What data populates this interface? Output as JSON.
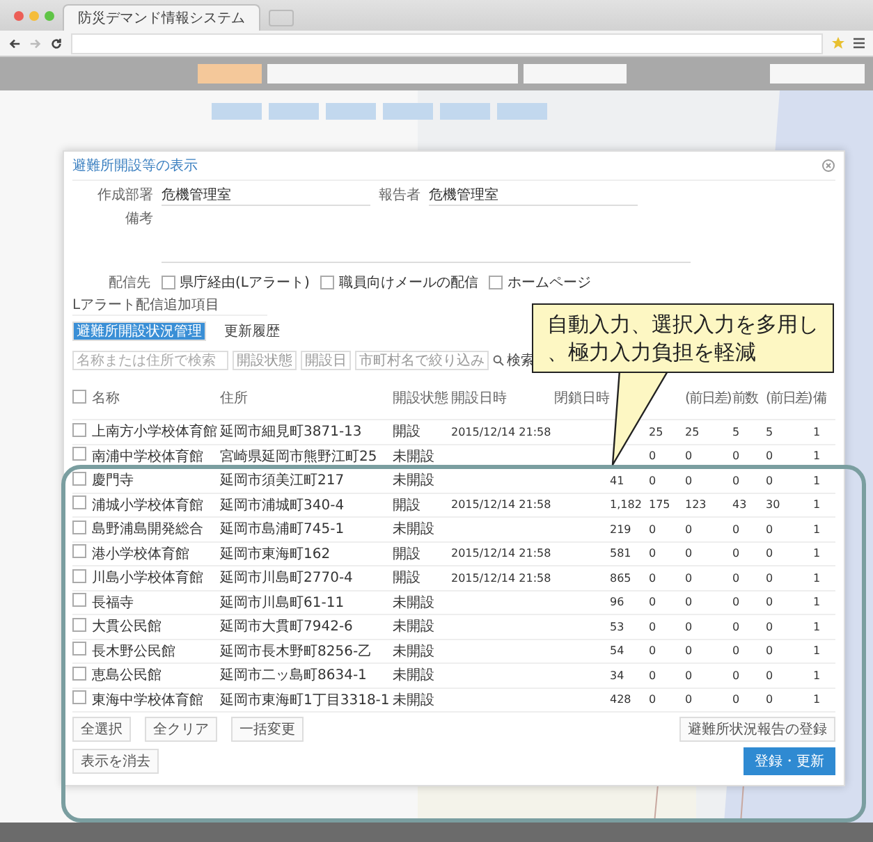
{
  "browser": {
    "tab_title": "防災デマンド情報システム"
  },
  "modal": {
    "title": "避難所開設等の表示",
    "fields": [
      {
        "label": "作成部署",
        "value": "危機管理室"
      },
      {
        "label": "報告者",
        "value": "危機管理室"
      }
    ],
    "remarks_label": "備考",
    "delivery": {
      "label": "配信先",
      "options": [
        {
          "label": "県庁経由(Lアラート)",
          "checked": false
        },
        {
          "label": "職員向けメールの配信",
          "checked": false
        },
        {
          "label": "ホームページ",
          "checked": false
        }
      ]
    },
    "section_label": "Lアラート配信追加項目",
    "tabs": [
      {
        "label": "避難所開設状況管理",
        "selected": true
      },
      {
        "label": "更新履歴",
        "selected": false
      }
    ],
    "filters": {
      "search_placeholder": "名称または住所で検索",
      "selects": [
        "開設状態",
        "開設日",
        "市町村名で絞り込み"
      ],
      "search_button": "検索"
    },
    "table": {
      "columns": [
        "名称",
        "住所",
        "開設状態",
        "開設日時",
        "閉鎖日時"
      ],
      "all_checked": false,
      "count_columns": [
        "(前日差)",
        "前数",
        "(前日差)",
        "備"
      ],
      "rows": [
        {
          "checked": false,
          "name": "上南方小学校体育館",
          "address": "延岡市細見町3871-13",
          "status": "開設",
          "opened": "2015/12/14 21:58",
          "counts": [
            "25",
            "25",
            "5",
            "5",
            "1"
          ]
        },
        {
          "checked": false,
          "name": "南浦中学校体育館",
          "address": "宮崎県延岡市熊野江町25",
          "status": "未開設",
          "counts": [
            "0",
            "0",
            "0",
            "0",
            "1"
          ]
        },
        {
          "checked": false,
          "name": "慶門寺",
          "address": "延岡市須美江町217",
          "status": "未開設",
          "counts": [
            "41",
            "0",
            "0",
            "0",
            "0",
            "1"
          ]
        },
        {
          "checked": false,
          "name": "浦城小学校体育館",
          "address": "延岡市浦城町340-4",
          "status": "開設",
          "opened": "2015/12/14 21:58",
          "counts": [
            "1,182",
            "175",
            "123",
            "43",
            "30",
            "1"
          ]
        },
        {
          "checked": false,
          "name": "島野浦島開発総合",
          "address": "延岡市島浦町745-1",
          "status": "未開設",
          "counts": [
            "219",
            "0",
            "0",
            "0",
            "0",
            "1"
          ]
        },
        {
          "checked": false,
          "name": "港小学校体育館",
          "address": "延岡市東海町162",
          "status": "開設",
          "opened": "2015/12/14 21:58",
          "counts": [
            "581",
            "0",
            "0",
            "0",
            "0",
            "1"
          ]
        },
        {
          "checked": false,
          "name": "川島小学校体育館",
          "address": "延岡市川島町2770-4",
          "status": "開設",
          "opened": "2015/12/14 21:58",
          "counts": [
            "865",
            "0",
            "0",
            "0",
            "0",
            "1"
          ]
        },
        {
          "checked": false,
          "name": "長福寺",
          "address": "延岡市川島町61-11",
          "status": "未開設",
          "counts": [
            "96",
            "0",
            "0",
            "0",
            "0",
            "1"
          ]
        },
        {
          "checked": false,
          "name": "大貫公民館",
          "address": "延岡市大貫町7942-6",
          "status": "未開設",
          "counts": [
            "53",
            "0",
            "0",
            "0",
            "0",
            "1"
          ]
        },
        {
          "checked": false,
          "name": "長木野公民館",
          "address": "延岡市長木野町8256-乙",
          "status": "未開設",
          "counts": [
            "54",
            "0",
            "0",
            "0",
            "0",
            "1"
          ]
        },
        {
          "checked": false,
          "name": "恵島公民館",
          "address": "延岡市二ッ島町8634-1",
          "status": "未開設",
          "counts": [
            "34",
            "0",
            "0",
            "0",
            "0",
            "1"
          ]
        },
        {
          "checked": false,
          "name": "東海中学校体育館",
          "address": "延岡市東海町1丁目3318-1",
          "status": "未開設",
          "counts": [
            "428",
            "0",
            "0",
            "0",
            "0",
            "1"
          ]
        }
      ]
    },
    "footer_buttons": [
      "全選択",
      "全クリア",
      "一括変更"
    ],
    "report_button": "避難所状況報告の登録",
    "clear_button": "表示を消去",
    "submit_button": "登録・更新"
  },
  "callout": {
    "text": "自動入力、選択入力を多用し、極力入力負担を軽減"
  }
}
